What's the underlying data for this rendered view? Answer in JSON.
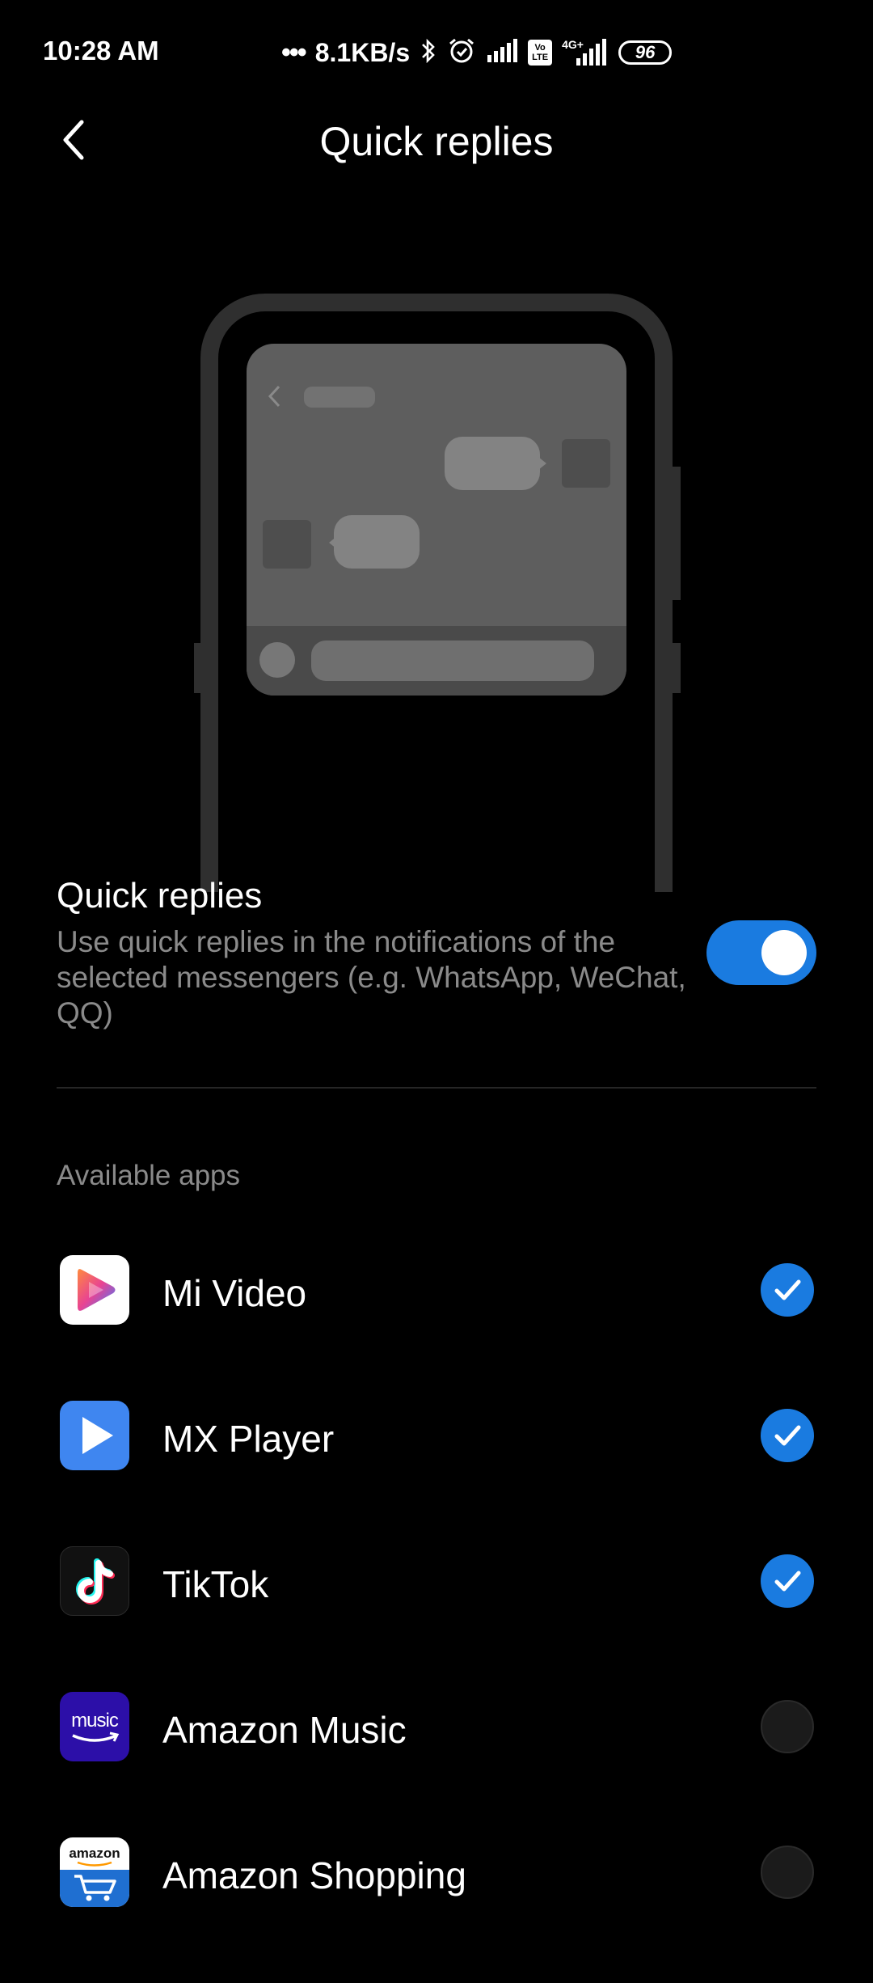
{
  "status_bar": {
    "time": "10:28 AM",
    "dots": "•••",
    "net_speed": "8.1KB/s",
    "volte_top": "Vo",
    "volte_bottom": "LTE",
    "network_type": "4G+",
    "battery": "96",
    "icons": [
      "bluetooth-icon",
      "alarm-icon",
      "signal-icon",
      "volte-icon",
      "signal-4g-icon",
      "battery-icon"
    ]
  },
  "header": {
    "title": "Quick replies",
    "back_icon": "back-arrow-icon"
  },
  "setting": {
    "title": "Quick replies",
    "description": "Use quick replies in the notifications of the selected messengers (e.g. WhatsApp, WeChat, QQ)",
    "enabled": true,
    "accent_color": "#1a7be0"
  },
  "apps_section": {
    "header": "Available apps",
    "apps": [
      {
        "name": "Mi Video",
        "icon": "mi-video-icon",
        "checked": true
      },
      {
        "name": "MX Player",
        "icon": "mx-player-icon",
        "checked": true
      },
      {
        "name": "TikTok",
        "icon": "tiktok-icon",
        "checked": true
      },
      {
        "name": "Amazon Music",
        "icon": "amazon-music-icon",
        "icon_text": "music",
        "checked": false
      },
      {
        "name": "Amazon Shopping",
        "icon": "amazon-shopping-icon",
        "icon_text": "amazon",
        "checked": false
      }
    ]
  }
}
